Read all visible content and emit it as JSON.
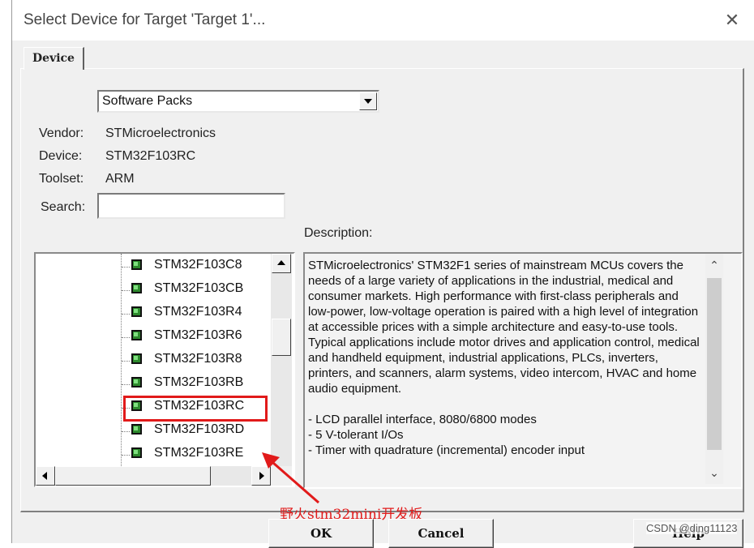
{
  "window": {
    "title": "Select Device for Target 'Target 1'...",
    "close_glyph": "✕"
  },
  "tab": {
    "label": "Device"
  },
  "combo": {
    "value": "Software Packs"
  },
  "fields": {
    "vendor_label": "Vendor:",
    "vendor_value": "STMicroelectronics",
    "device_label": "Device:",
    "device_value": "STM32F103RC",
    "toolset_label": "Toolset:",
    "toolset_value": "ARM",
    "search_label": "Search:",
    "search_value": ""
  },
  "tree": {
    "items": [
      "STM32F103C8",
      "STM32F103CB",
      "STM32F103R4",
      "STM32F103R6",
      "STM32F103R8",
      "STM32F103RB",
      "STM32F103RC",
      "STM32F103RD",
      "STM32F103RE"
    ],
    "selected": "STM32F103RC",
    "item_icon": "chip-icon"
  },
  "description": {
    "label": "Description:",
    "paragraphs": [
      "STMicroelectronics' STM32F1 series of mainstream MCUs covers the needs of a large variety of applications in the industrial, medical and consumer markets. High performance with first-class peripherals and low-power, low-voltage operation is paired with a high level of integration at accessible prices with a simple architecture and easy-to-use tools.",
      "Typical applications include motor drives and application control, medical and handheld equipment, industrial applications, PLCs, inverters, printers, and scanners, alarm systems, video intercom, HVAC and home audio equipment.",
      "",
      " - LCD parallel interface, 8080/6800 modes",
      " - 5 V-tolerant I/Os",
      " - Timer with quadrature (incremental) encoder input"
    ]
  },
  "annotation": {
    "text": "野火stm32mini开发板",
    "color": "#e11a1a"
  },
  "buttons": {
    "ok": "OK",
    "cancel": "Cancel",
    "help": "Help"
  },
  "watermark": "CSDN @ding11123"
}
